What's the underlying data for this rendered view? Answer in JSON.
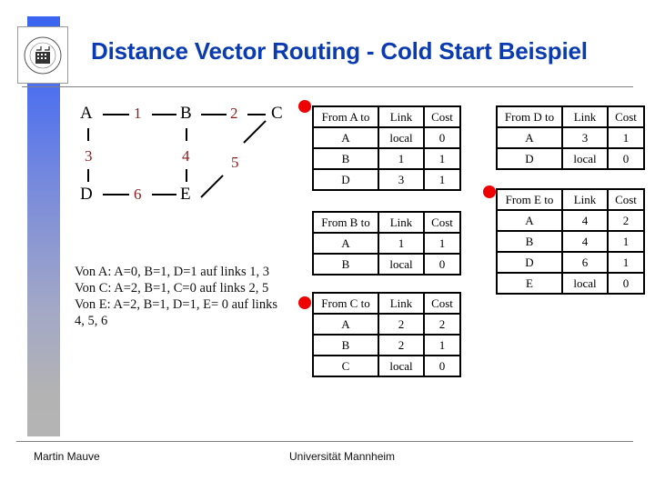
{
  "slide": {
    "title": "Distance Vector Routing - Cold Start Beispiel",
    "footer_author": "Martin Mauve",
    "footer_institution": "Universität Mannheim",
    "logo_icon": "university-seal-icon",
    "accent_color": "#0b3bb0",
    "marker_color": "#ee0000",
    "cost_color": "#8b1a1a"
  },
  "graph": {
    "nodes": [
      "A",
      "B",
      "C",
      "D",
      "E"
    ],
    "links": [
      {
        "id": "1",
        "from": "A",
        "to": "B"
      },
      {
        "id": "2",
        "from": "B",
        "to": "C"
      },
      {
        "id": "3",
        "from": "A",
        "to": "D"
      },
      {
        "id": "4",
        "from": "B",
        "to": "E"
      },
      {
        "id": "5",
        "from": "C",
        "to": "E"
      },
      {
        "id": "6",
        "from": "D",
        "to": "E"
      }
    ]
  },
  "notes": [
    "Von A: A=0, B=1, D=1 auf links 1, 3",
    "Von C: A=2, B=1, C=0 auf links 2, 5",
    "Von E: A=2, B=1, D=1, E= 0 auf links 4, 5, 6"
  ],
  "tables": [
    {
      "header": [
        "From A to",
        "Link",
        "Cost"
      ],
      "marked": true,
      "rows": [
        [
          "A",
          "local",
          "0"
        ],
        [
          "B",
          "1",
          "1"
        ],
        [
          "D",
          "3",
          "1"
        ]
      ]
    },
    {
      "header": [
        "From B to",
        "Link",
        "Cost"
      ],
      "marked": false,
      "rows": [
        [
          "A",
          "1",
          "1"
        ],
        [
          "B",
          "local",
          "0"
        ]
      ]
    },
    {
      "header": [
        "From C to",
        "Link",
        "Cost"
      ],
      "marked": true,
      "rows": [
        [
          "A",
          "2",
          "2"
        ],
        [
          "B",
          "2",
          "1"
        ],
        [
          "C",
          "local",
          "0"
        ]
      ]
    },
    {
      "header": [
        "From D to",
        "Link",
        "Cost"
      ],
      "marked": false,
      "rows": [
        [
          "A",
          "3",
          "1"
        ],
        [
          "D",
          "local",
          "0"
        ]
      ]
    },
    {
      "header": [
        "From E to",
        "Link",
        "Cost"
      ],
      "marked": true,
      "rows": [
        [
          "A",
          "4",
          "2"
        ],
        [
          "B",
          "4",
          "1"
        ],
        [
          "D",
          "6",
          "1"
        ],
        [
          "E",
          "local",
          "0"
        ]
      ]
    }
  ]
}
